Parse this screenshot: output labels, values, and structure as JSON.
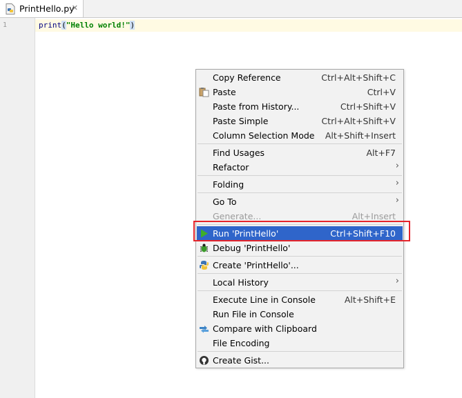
{
  "tab": {
    "title": "PrintHello.py",
    "close_icon": "close-icon",
    "file_icon": "python-file-icon"
  },
  "editor": {
    "line_number": "1",
    "code": {
      "func": "print",
      "open": "(",
      "string": "\"Hello world!\"",
      "close": ")"
    }
  },
  "context_menu": {
    "items": [
      {
        "label": "Copy Reference",
        "shortcut": "Ctrl+Alt+Shift+C"
      },
      {
        "label": "Paste",
        "shortcut": "Ctrl+V",
        "icon": "clipboard-icon"
      },
      {
        "label": "Paste from History...",
        "shortcut": "Ctrl+Shift+V"
      },
      {
        "label": "Paste Simple",
        "shortcut": "Ctrl+Alt+Shift+V"
      },
      {
        "label": "Column Selection Mode",
        "shortcut": "Alt+Shift+Insert"
      },
      {
        "label": "Find Usages",
        "shortcut": "Alt+F7"
      },
      {
        "label": "Refactor",
        "submenu": true
      },
      {
        "label": "Folding",
        "submenu": true
      },
      {
        "label": "Go To",
        "submenu": true
      },
      {
        "label": "Generate...",
        "shortcut": "Alt+Insert",
        "disabled": true
      },
      {
        "label": "Run 'PrintHello'",
        "shortcut": "Ctrl+Shift+F10",
        "icon": "run-icon",
        "selected": true
      },
      {
        "label": "Debug 'PrintHello'",
        "icon": "debug-icon"
      },
      {
        "label": "Create 'PrintHello'...",
        "icon": "python-icon"
      },
      {
        "label": "Local History",
        "submenu": true
      },
      {
        "label": "Execute Line in Console",
        "shortcut": "Alt+Shift+E"
      },
      {
        "label": "Run File in Console"
      },
      {
        "label": "Compare with Clipboard",
        "icon": "compare-icon"
      },
      {
        "label": "File Encoding"
      },
      {
        "label": "Create Gist...",
        "icon": "github-icon"
      }
    ],
    "submenu_arrow": "›"
  },
  "colors": {
    "selection": "#2f65ca",
    "highlight_box": "#e5242a",
    "run_green": "#3fae29"
  }
}
